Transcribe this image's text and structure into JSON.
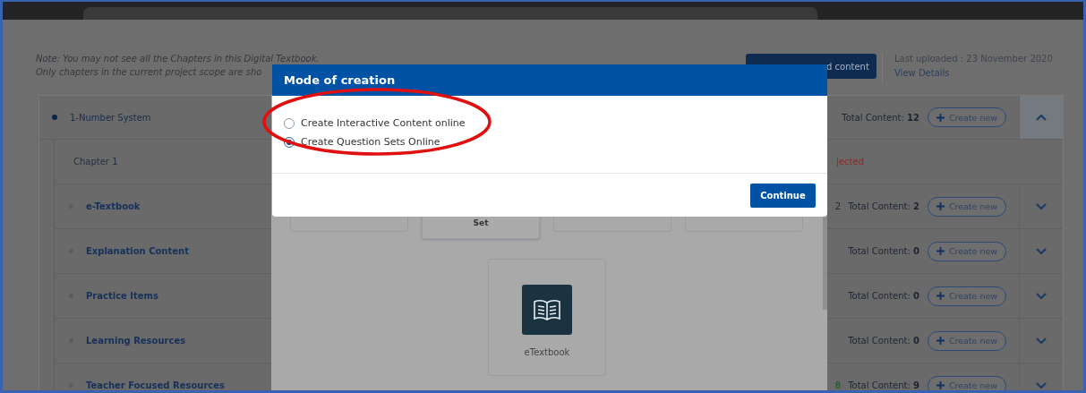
{
  "note": [
    "Note: You may not see all the Chapters in this Digital Textbook.",
    "Only chapters in the current project scope are sho"
  ],
  "upload_button": "d content",
  "last_uploaded": "Last uploaded : 23 November 2020",
  "view_details": "View Details",
  "chapter": {
    "title": "1-Number System",
    "total_label": "Total Content:",
    "total": "12",
    "create": "Create new",
    "expanded": true
  },
  "sub_row": {
    "label": "Chapter 1",
    "status": "jected"
  },
  "sections": [
    {
      "name": "e-Textbook",
      "badge": "2",
      "total_label": "Total Content:",
      "total": "2",
      "create": "Create new",
      "expanded": false
    },
    {
      "name": "Explanation Content",
      "total_label": "Total Content:",
      "total": "0",
      "create": "Create new",
      "expanded": false
    },
    {
      "name": "Practice Items",
      "total_label": "Total Content:",
      "total": "0",
      "create": "Create new",
      "expanded": false
    },
    {
      "name": "Learning Resources",
      "total_label": "Total Content:",
      "total": "0",
      "create": "Create new",
      "expanded": false
    },
    {
      "name": "Teacher Focused Resources",
      "badge": "8",
      "total_label": "Total Content:",
      "total": "9",
      "create": "Create new",
      "expanded": false
    }
  ],
  "picker": {
    "cards": [
      {
        "kind": "blank"
      },
      {
        "kind": "labeled",
        "label": "Set"
      },
      {
        "kind": "blank"
      },
      {
        "kind": "blank"
      }
    ],
    "etextbook": "eTextbook"
  },
  "dialog": {
    "title": "Mode of creation",
    "options": [
      {
        "label": "Create Interactive Content online",
        "selected": false
      },
      {
        "label": "Create Question Sets Online",
        "selected": true
      }
    ],
    "button": "Continue"
  }
}
